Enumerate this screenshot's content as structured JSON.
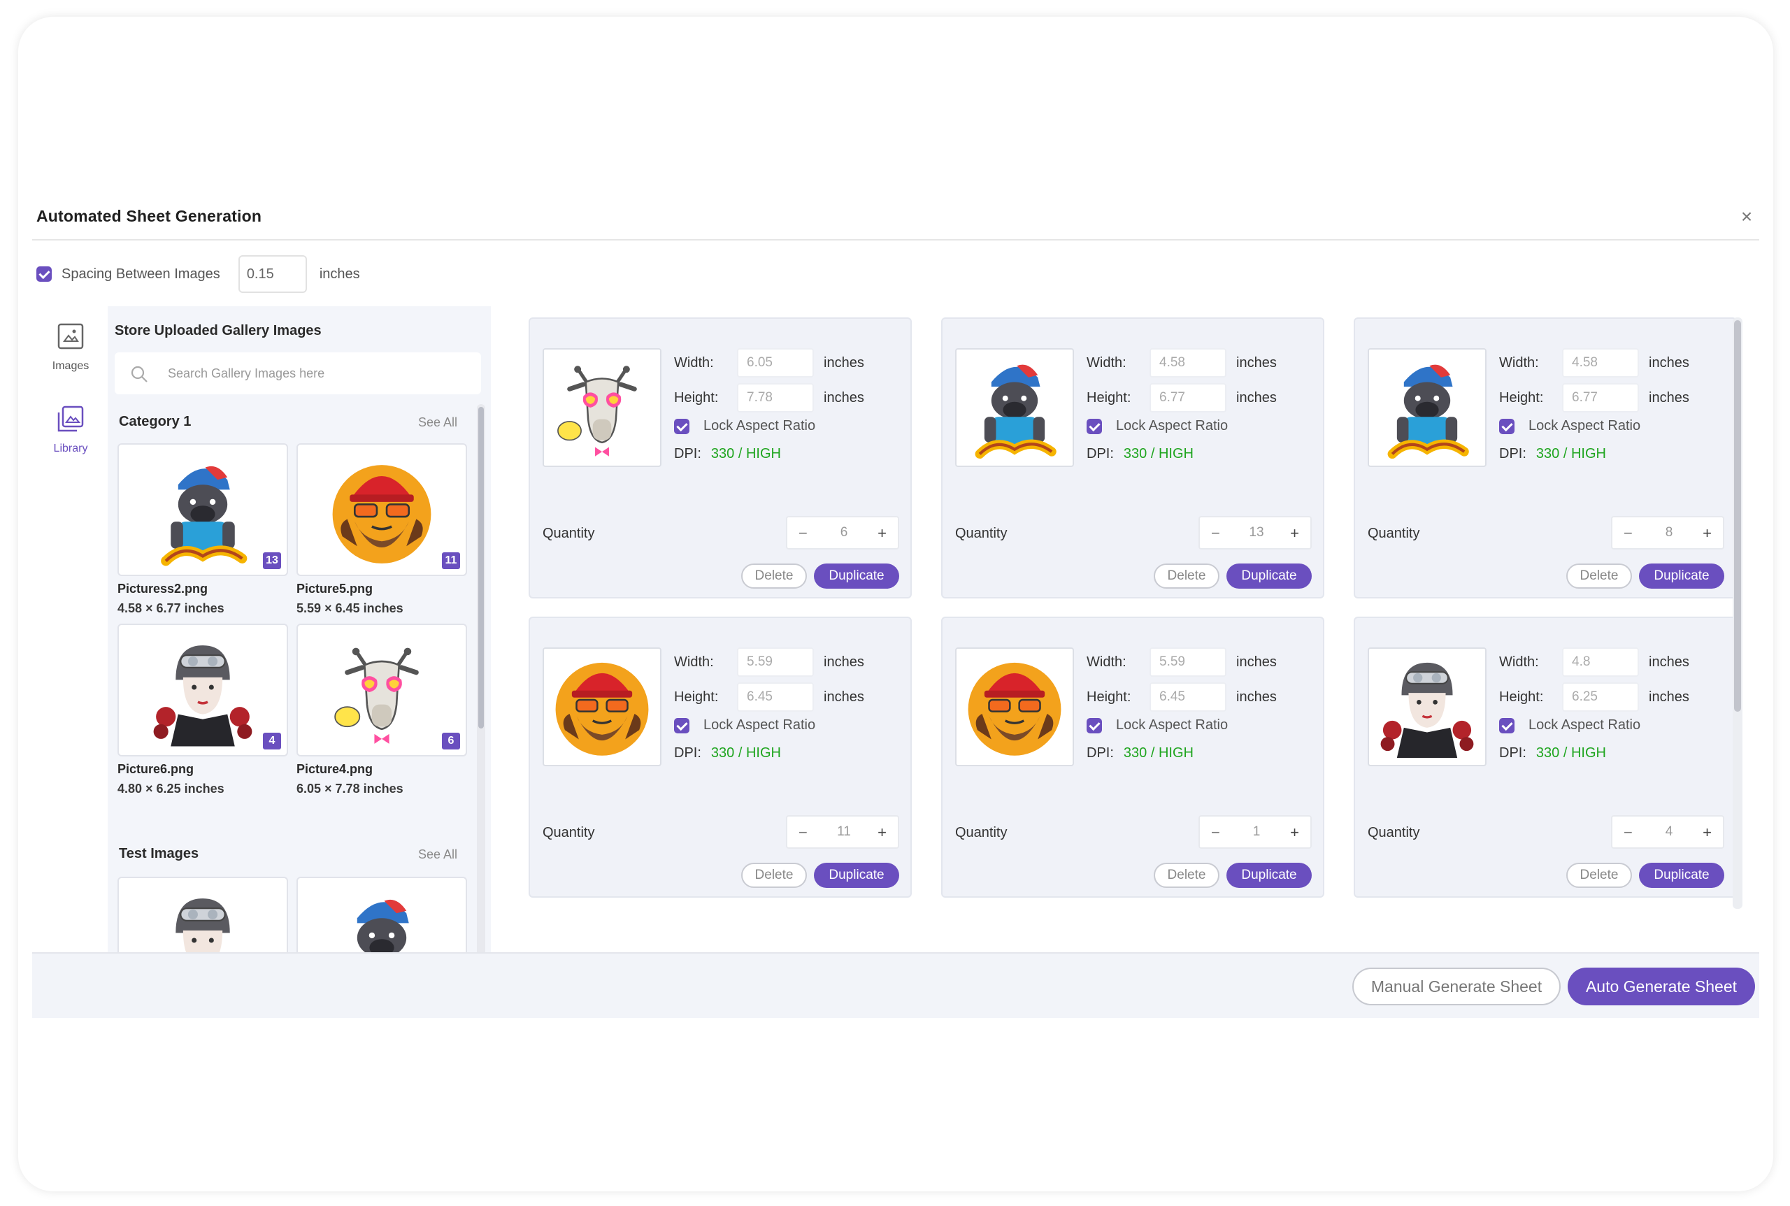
{
  "dialog": {
    "title": "Automated Sheet Generation",
    "close_icon": "close-icon"
  },
  "spacing": {
    "checked": true,
    "label": "Spacing Between Images",
    "value": "0.15",
    "unit": "inches"
  },
  "rail": {
    "images_label": "Images",
    "library_label": "Library"
  },
  "gallery": {
    "heading": "Store Uploaded Gallery Images",
    "search_placeholder": "Search Gallery Images here",
    "categories": [
      {
        "title": "Category 1",
        "see_all": "See All",
        "items": [
          {
            "name": "Picturess2.png",
            "dims": "4.58 × 6.77 inches",
            "count": "13",
            "art": "bulldog"
          },
          {
            "name": "Picture5.png",
            "dims": "5.59 × 6.45 inches",
            "count": "11",
            "art": "redhat"
          },
          {
            "name": "Picture6.png",
            "dims": "4.80 × 6.25 inches",
            "count": "4",
            "art": "biker"
          },
          {
            "name": "Picture4.png",
            "dims": "6.05 × 7.78 inches",
            "count": "6",
            "art": "giraffe"
          }
        ]
      },
      {
        "title": "Test Images",
        "see_all": "See All"
      }
    ]
  },
  "card_labels": {
    "width": "Width:",
    "height": "Height:",
    "unit": "inches",
    "lock": "Lock Aspect Ratio",
    "dpi": "DPI:",
    "quantity": "Quantity",
    "delete": "Delete",
    "duplicate": "Duplicate",
    "minus": "−",
    "plus": "+"
  },
  "cards": [
    {
      "art": "giraffe",
      "width": "6.05",
      "height": "7.78",
      "dpi": "330 / HIGH",
      "qty": "6"
    },
    {
      "art": "bulldog",
      "width": "4.58",
      "height": "6.77",
      "dpi": "330 / HIGH",
      "qty": "13"
    },
    {
      "art": "bulldog",
      "width": "4.58",
      "height": "6.77",
      "dpi": "330 / HIGH",
      "qty": "8"
    },
    {
      "art": "redhat",
      "width": "5.59",
      "height": "6.45",
      "dpi": "330 / HIGH",
      "qty": "11"
    },
    {
      "art": "redhat",
      "width": "5.59",
      "height": "6.45",
      "dpi": "330 / HIGH",
      "qty": "1"
    },
    {
      "art": "biker",
      "width": "4.8",
      "height": "6.25",
      "dpi": "330 / HIGH",
      "qty": "4"
    }
  ],
  "footer": {
    "manual_label": "Manual Generate Sheet",
    "auto_label": "Auto Generate Sheet"
  },
  "colors": {
    "accent": "#6a4fbf",
    "dpi_high": "#1fa51f"
  }
}
